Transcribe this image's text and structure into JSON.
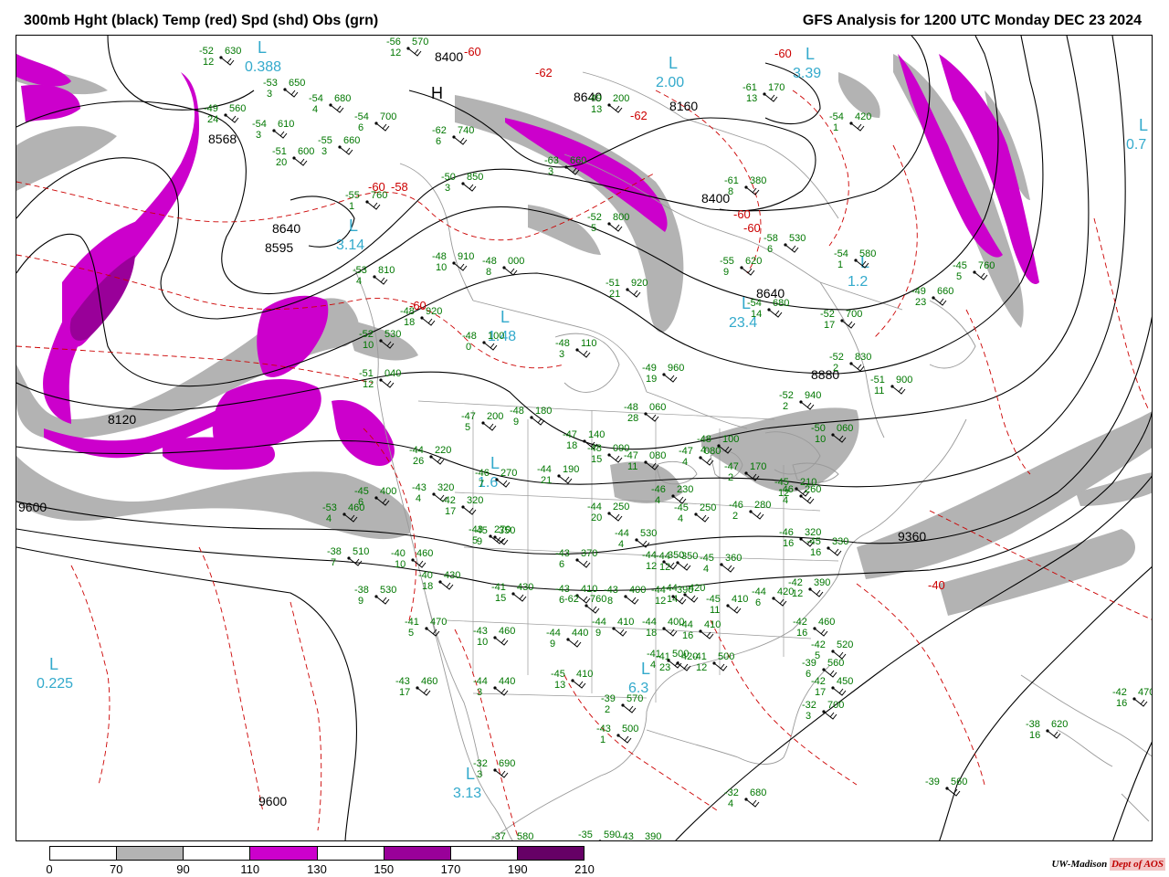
{
  "title_left": "300mb Hght (black) Temp (red) Spd (shd) Obs (grn)",
  "title_right": "GFS Analysis for 1200 UTC Monday  DEC 23 2024",
  "legend": {
    "ticks": [
      "0",
      "70",
      "90",
      "110",
      "130",
      "150",
      "170",
      "190",
      "210"
    ],
    "colors": [
      "#ffffff",
      "#b3b3b3",
      "#ffffff",
      "#cc00cc",
      "#ffffff",
      "#990099",
      "#ffffff",
      "#660066"
    ]
  },
  "credit": {
    "org": "UW-Madison",
    "dept": "Dept of AOS"
  },
  "colors": {
    "height": "#000000",
    "temp": "#cc0000",
    "obs": "#007700",
    "lowlabel": "#33aacc",
    "shade70": "#b3b3b3",
    "shade110": "#cc00cc",
    "shade150": "#990099"
  },
  "height_labels": [
    "8400",
    "8640",
    "8568",
    "8160",
    "8400",
    "8640",
    "8595",
    "8640",
    "8880",
    "8120",
    "9600",
    "9360",
    "9600"
  ],
  "temp_labels": [
    "-60",
    "-62",
    "-60",
    "-62",
    "-60",
    "-60",
    "-60",
    "-58",
    "-60",
    "-40"
  ],
  "pressure_centers": [
    {
      "letter": "L",
      "value": "0.388"
    },
    {
      "letter": "L",
      "value": "2.00"
    },
    {
      "letter": "L",
      "value": "3.39"
    },
    {
      "letter": "L",
      "value": "0.7"
    },
    {
      "letter": "L",
      "value": "3.14"
    },
    {
      "letter": "L",
      "value": "1.48"
    },
    {
      "letter": "L",
      "value": "1.2"
    },
    {
      "letter": "L",
      "value": "23.4"
    },
    {
      "letter": "L",
      "value": "1.6"
    },
    {
      "letter": "L",
      "value": "0.225"
    },
    {
      "letter": "L",
      "value": "6.3"
    },
    {
      "letter": "L",
      "value": "3.13"
    },
    {
      "letter": "H",
      "value": ""
    }
  ],
  "observations": [
    {
      "t": "-52",
      "h": "630",
      "d": "12"
    },
    {
      "t": "-53",
      "h": "650",
      "d": "3"
    },
    {
      "t": "-56",
      "h": "570",
      "d": "12"
    },
    {
      "t": "-49",
      "h": "560",
      "d": "24"
    },
    {
      "t": "-54",
      "h": "680",
      "d": "4"
    },
    {
      "t": "-54",
      "h": "700",
      "d": "6"
    },
    {
      "t": "-54",
      "h": "610",
      "d": "3"
    },
    {
      "t": "-55",
      "h": "660",
      "d": "3"
    },
    {
      "t": "-51",
      "h": "600",
      "d": "20"
    },
    {
      "t": "-62",
      "h": "740",
      "d": "6"
    },
    {
      "t": "-50",
      "h": "850",
      "d": "3"
    },
    {
      "t": "-52",
      "h": "800",
      "d": "5"
    },
    {
      "t": "-49",
      "h": "200",
      "d": "13"
    },
    {
      "t": "-63",
      "h": "660",
      "d": "3"
    },
    {
      "t": "-61",
      "h": "380",
      "d": "8"
    },
    {
      "t": "-61",
      "h": "170",
      "d": "13"
    },
    {
      "t": "-54",
      "h": "420",
      "d": "1"
    },
    {
      "t": "-55",
      "h": "760",
      "d": "1"
    },
    {
      "t": "-48",
      "h": "910",
      "d": "10"
    },
    {
      "t": "-48",
      "h": "000",
      "d": "8"
    },
    {
      "t": "-51",
      "h": "920",
      "d": "21"
    },
    {
      "t": "-55",
      "h": "620",
      "d": "9"
    },
    {
      "t": "-58",
      "h": "530",
      "d": "6"
    },
    {
      "t": "-54",
      "h": "580",
      "d": "1"
    },
    {
      "t": "-45",
      "h": "760",
      "d": "5"
    },
    {
      "t": "-53",
      "h": "810",
      "d": "4"
    },
    {
      "t": "-48",
      "h": "920",
      "d": "18"
    },
    {
      "t": "-48",
      "h": "100",
      "d": "0"
    },
    {
      "t": "-48",
      "h": "110",
      "d": "3"
    },
    {
      "t": "-49",
      "h": "960",
      "d": "19"
    },
    {
      "t": "-54",
      "h": "680",
      "d": "14"
    },
    {
      "t": "-52",
      "h": "700",
      "d": "17"
    },
    {
      "t": "-49",
      "h": "660",
      "d": "23"
    },
    {
      "t": "-52",
      "h": "830",
      "d": "2"
    },
    {
      "t": "-52",
      "h": "940",
      "d": "2"
    },
    {
      "t": "-51",
      "h": "900",
      "d": "11"
    },
    {
      "t": "-52",
      "h": "530",
      "d": "10"
    },
    {
      "t": "-51",
      "h": "040",
      "d": "12"
    },
    {
      "t": "-47",
      "h": "200",
      "d": "5"
    },
    {
      "t": "-48",
      "h": "180",
      "d": "9"
    },
    {
      "t": "-48",
      "h": "060",
      "d": "28"
    },
    {
      "t": "-47",
      "h": "140",
      "d": "18"
    },
    {
      "t": "-48",
      "h": "090",
      "d": "15"
    },
    {
      "t": "-50",
      "h": "060",
      "d": "10"
    },
    {
      "t": "-47",
      "h": "080",
      "d": "11"
    },
    {
      "t": "-47",
      "h": "080",
      "d": "4"
    },
    {
      "t": "-48",
      "h": "100",
      "d": "4"
    },
    {
      "t": "-47",
      "h": "170",
      "d": "2"
    },
    {
      "t": "-44",
      "h": "220",
      "d": "26"
    },
    {
      "t": "-46",
      "h": "270",
      "d": "7"
    },
    {
      "t": "-44",
      "h": "190",
      "d": "21"
    },
    {
      "t": "-44",
      "h": "250",
      "d": "20"
    },
    {
      "t": "-46",
      "h": "230",
      "d": "4"
    },
    {
      "t": "-45",
      "h": "250",
      "d": "4"
    },
    {
      "t": "-46",
      "h": "280",
      "d": "2"
    },
    {
      "t": "-45",
      "h": "210",
      "d": "12"
    },
    {
      "t": "-46",
      "h": "260",
      "d": "4"
    },
    {
      "t": "-45",
      "h": "400",
      "d": "6"
    },
    {
      "t": "-53",
      "h": "460",
      "d": "4"
    },
    {
      "t": "-43",
      "h": "320",
      "d": "4"
    },
    {
      "t": "-42",
      "h": "320",
      "d": "17"
    },
    {
      "t": "-43",
      "h": "270",
      "d": "5"
    },
    {
      "t": "-45",
      "h": "350",
      "d": "9"
    },
    {
      "t": "-44",
      "h": "530",
      "d": "4"
    },
    {
      "t": "-46",
      "h": "320",
      "d": "16"
    },
    {
      "t": "-45",
      "h": "330",
      "d": "16"
    },
    {
      "t": "-44",
      "h": "350",
      "d": "12"
    },
    {
      "t": "-38",
      "h": "510",
      "d": "7"
    },
    {
      "t": "-40",
      "h": "460",
      "d": "10"
    },
    {
      "t": "-43",
      "h": "370",
      "d": "6"
    },
    {
      "t": "-44",
      "h": "350",
      "d": "12"
    },
    {
      "t": "-45",
      "h": "360",
      "d": "4"
    },
    {
      "t": "-42",
      "h": "390",
      "d": "12"
    },
    {
      "t": "-44",
      "h": "420",
      "d": "14"
    },
    {
      "t": "-38",
      "h": "530",
      "d": "9"
    },
    {
      "t": "-40",
      "h": "430",
      "d": "18"
    },
    {
      "t": "-41",
      "h": "430",
      "d": "15"
    },
    {
      "t": "-43",
      "h": "410",
      "d": "6"
    },
    {
      "t": "-43",
      "h": "400",
      "d": "8"
    },
    {
      "t": "-44",
      "h": "390",
      "d": "12"
    },
    {
      "t": "-45",
      "h": "410",
      "d": "11"
    },
    {
      "t": "-44",
      "h": "420",
      "d": "6"
    },
    {
      "t": "-41",
      "h": "470",
      "d": "5"
    },
    {
      "t": "-43",
      "h": "460",
      "d": "10"
    },
    {
      "t": "-44",
      "h": "440",
      "d": "9"
    },
    {
      "t": "-44",
      "h": "410",
      "d": "9"
    },
    {
      "t": "-44",
      "h": "400",
      "d": "18"
    },
    {
      "t": "-44",
      "h": "410",
      "d": "16"
    },
    {
      "t": "-42",
      "h": "460",
      "d": "16"
    },
    {
      "t": "-41",
      "h": "420",
      "d": "23"
    },
    {
      "t": "-41",
      "h": "500",
      "d": "12"
    },
    {
      "t": "-42",
      "h": "520",
      "d": "5"
    },
    {
      "t": "-43",
      "h": "460",
      "d": "17"
    },
    {
      "t": "-44",
      "h": "440",
      "d": "3"
    },
    {
      "t": "-45",
      "h": "410",
      "d": "13"
    },
    {
      "t": "-41",
      "h": "500",
      "d": "4"
    },
    {
      "t": "-39",
      "h": "560",
      "d": "6"
    },
    {
      "t": "-42",
      "h": "450",
      "d": "17"
    },
    {
      "t": "-39",
      "h": "570",
      "d": "2"
    },
    {
      "t": "-32",
      "h": "700",
      "d": "3"
    },
    {
      "t": "-42",
      "h": "470",
      "d": "16"
    },
    {
      "t": "-43",
      "h": "500",
      "d": "1"
    },
    {
      "t": "-32",
      "h": "690",
      "d": "3"
    },
    {
      "t": "-38",
      "h": "620",
      "d": "16"
    },
    {
      "t": "-32",
      "h": "680",
      "d": "4"
    },
    {
      "t": "-39",
      "h": "560",
      "d": ""
    },
    {
      "t": "-37",
      "h": "580",
      "d": ""
    },
    {
      "t": "-35",
      "h": "590",
      "d": ""
    },
    {
      "t": "-43",
      "h": "390",
      "d": "4"
    },
    {
      "t": "-62",
      "h": "760",
      "d": ""
    }
  ]
}
